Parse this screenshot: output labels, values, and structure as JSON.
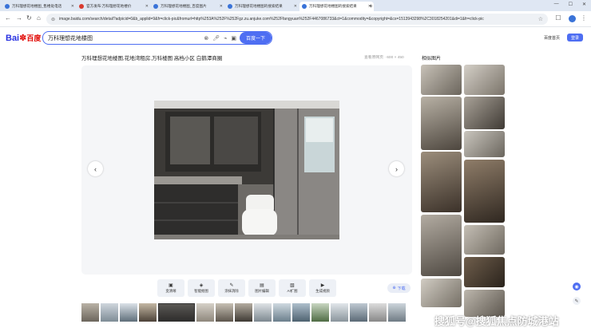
{
  "browser": {
    "tabs": [
      {
        "title": "万科理想花地楼图_售楼处电话",
        "active": false,
        "favicon": "baidu"
      },
      {
        "title": "官方发布:万科理想花地楼价",
        "active": false,
        "favicon": "red"
      },
      {
        "title": "万科理想花地楼图_百度图片",
        "active": false,
        "favicon": "baidu"
      },
      {
        "title": "万科理想花地楼图的搜索结果",
        "active": false,
        "favicon": "baidu"
      },
      {
        "title": "万科理想花地楼图的搜索结果",
        "active": true,
        "favicon": "baidu"
      }
    ],
    "new_tab": "+",
    "url": "image.baidu.com/search/detail?adpicid=0&b_applid=9&fr=click-pic&fromurl=http%253A%252F%252Fgz.zu.anjuke.com%252Ffangyuan%252F4467086733&ct=1&commodity=&copyright=&cs=1513943298%2C3018254201&di=1&fr=click-pic"
  },
  "baidu": {
    "logo_text": "Bai",
    "logo_paw": "du",
    "logo_cn": "百度",
    "search_value": "万科理想花地楼图",
    "search_button": "百度一下",
    "home_link": "百度首页",
    "login_button": "登录"
  },
  "image": {
    "title": "万科理想花地楼图,花地湾租房,万科楼图 高档小区 白鹅潭商圈",
    "meta": "查看原网页 · 600 × 450"
  },
  "tools": [
    {
      "icon": "▣",
      "label": "变清晰"
    },
    {
      "icon": "◈",
      "label": "智能抠图"
    },
    {
      "icon": "✎",
      "label": "涂抹消除"
    },
    {
      "icon": "▤",
      "label": "图片编辑"
    },
    {
      "icon": "▧",
      "label": "AI扩图"
    },
    {
      "icon": "▶",
      "label": "生成视频"
    }
  ],
  "download_label": "下载",
  "related_title": "相似图片",
  "watermark": "搜狐号@搜狐焦点防城港站",
  "colors": {
    "accent": "#4e6ef2",
    "logo_blue": "#2932e1",
    "logo_red": "#e10601"
  }
}
